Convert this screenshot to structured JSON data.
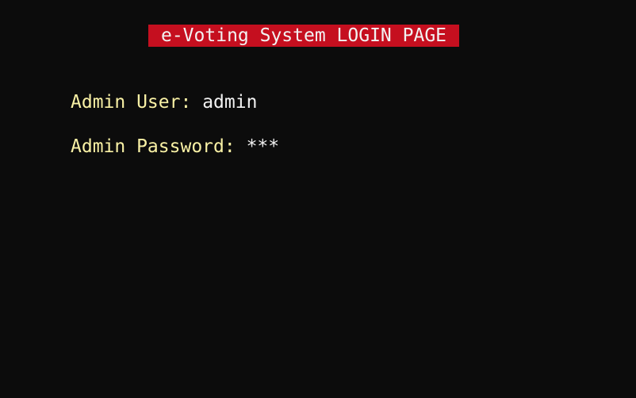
{
  "console": {
    "title": "e-Voting System LOGIN PAGE",
    "title_bg_color": "#c50f1f",
    "background_color": "#0c0c0c",
    "label_color": "#f9f1a5",
    "value_color": "#f2f2f2"
  },
  "login": {
    "user_label": "Admin User:",
    "user_value": "admin",
    "password_label": "Admin Password:",
    "password_value": "***"
  }
}
